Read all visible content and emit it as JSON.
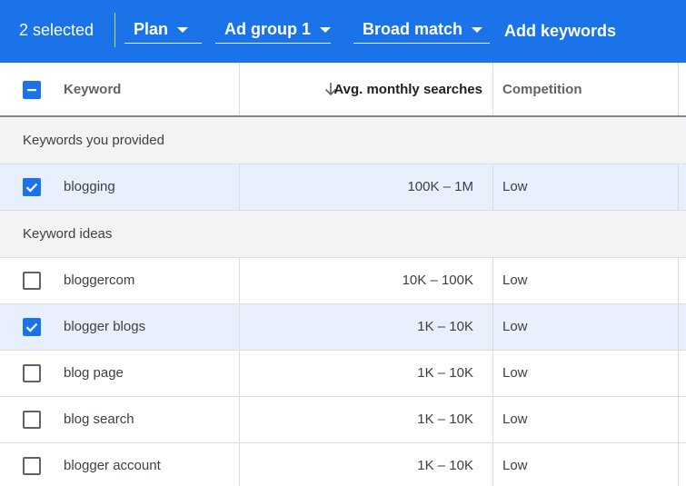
{
  "toolbar": {
    "selected_count": "2 selected",
    "plan_label": "Plan",
    "ad_group_label": "Ad group 1",
    "match_type_label": "Broad match",
    "add_keywords_label": "Add keywords",
    "accent_color": "#1a73e8"
  },
  "table": {
    "columns": {
      "keyword": "Keyword",
      "avg_monthly_searches": "Avg. monthly searches",
      "competition": "Competition"
    },
    "sort": {
      "column": "avg_monthly_searches",
      "direction": "descending",
      "icon": "arrow-down-icon"
    },
    "header_checkbox_state": "indeterminate",
    "groups": [
      {
        "label": "Keywords you provided",
        "rows": [
          {
            "keyword": "blogging",
            "avg": "100K – 1M",
            "competition": "Low",
            "checked": true
          }
        ]
      },
      {
        "label": "Keyword ideas",
        "rows": [
          {
            "keyword": "bloggercom",
            "avg": "10K – 100K",
            "competition": "Low",
            "checked": false
          },
          {
            "keyword": "blogger blogs",
            "avg": "1K – 10K",
            "competition": "Low",
            "checked": true
          },
          {
            "keyword": "blog page",
            "avg": "1K – 10K",
            "competition": "Low",
            "checked": false
          },
          {
            "keyword": "blog search",
            "avg": "1K – 10K",
            "competition": "Low",
            "checked": false
          },
          {
            "keyword": "blogger account",
            "avg": "1K – 10K",
            "competition": "Low",
            "checked": false
          }
        ]
      }
    ]
  }
}
